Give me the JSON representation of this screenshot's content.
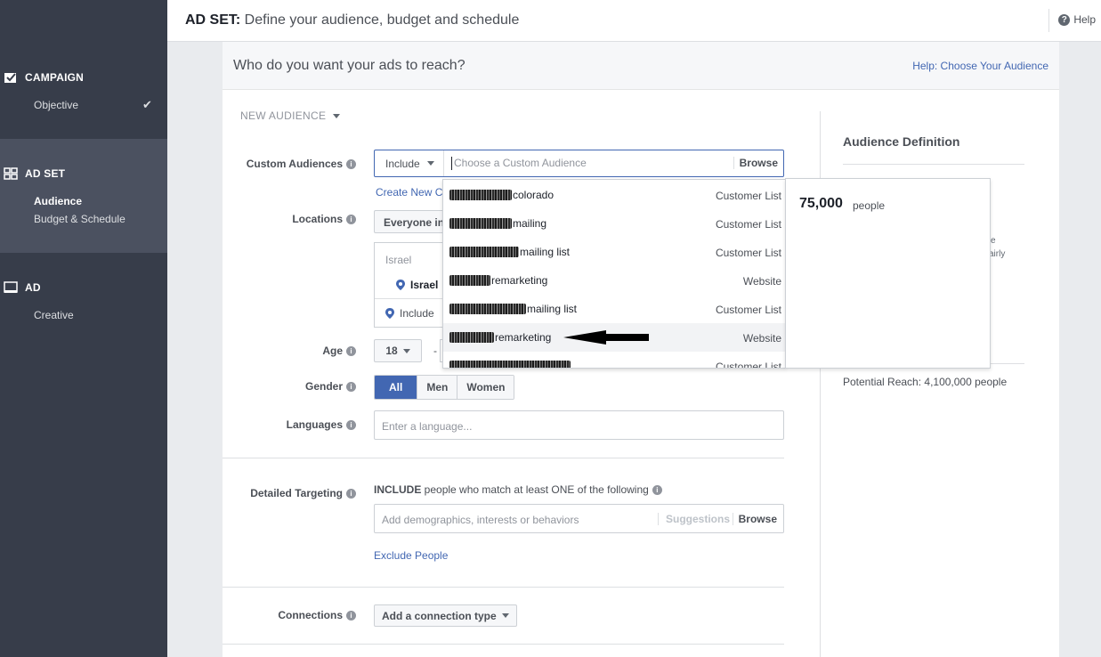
{
  "sidebar": {
    "campaign": {
      "title": "CAMPAIGN",
      "items": [
        {
          "label": "Objective"
        }
      ]
    },
    "adset": {
      "title": "AD SET",
      "items": [
        {
          "label": "Audience"
        },
        {
          "label": "Budget & Schedule"
        }
      ]
    },
    "ad": {
      "title": "AD",
      "items": [
        {
          "label": "Creative"
        }
      ]
    }
  },
  "header": {
    "title_bold": "AD SET:",
    "title_rest": " Define your audience, budget and schedule",
    "help_label": "Help"
  },
  "card": {
    "title": "Who do you want your ads to reach?",
    "help_link": "Help: Choose Your Audience",
    "new_audience": "NEW AUDIENCE"
  },
  "form": {
    "custom_audiences": {
      "label": "Custom Audiences",
      "include": "Include",
      "placeholder": "Choose a Custom Audience",
      "browse": "Browse",
      "create_new": "Create New C"
    },
    "locations": {
      "label": "Locations",
      "button": "Everyone in",
      "country_header": "Israel",
      "selected": "Israel",
      "include": "Include"
    },
    "age": {
      "label": "Age",
      "min": "18",
      "dash": "-"
    },
    "gender": {
      "label": "Gender",
      "options": [
        "All",
        "Men",
        "Women"
      ],
      "selected": "All"
    },
    "languages": {
      "label": "Languages",
      "placeholder": "Enter a language..."
    },
    "detailed_targeting": {
      "label": "Detailed Targeting",
      "desc_bold": "INCLUDE",
      "desc_rest": " people who match at least ONE of the following",
      "placeholder": "Add demographics, interests or behaviors",
      "suggestions": "Suggestions",
      "browse": "Browse",
      "exclude": "Exclude People"
    },
    "connections": {
      "label": "Connections",
      "button": "Add a connection type"
    }
  },
  "dropdown": {
    "items": [
      {
        "name": "colorado",
        "type": "Customer List",
        "blur": 70
      },
      {
        "name": "mailing",
        "type": "Customer List",
        "blur": 70
      },
      {
        "name": "mailing list",
        "type": "Customer List",
        "blur": 78
      },
      {
        "name": "remarketing",
        "type": "Website",
        "blur": 46
      },
      {
        "name": "mailing list",
        "type": "Customer List",
        "blur": 86
      },
      {
        "name": "remarketing",
        "type": "Website",
        "blur": 50
      },
      {
        "name": "",
        "type": "Customer List",
        "blur": 136
      }
    ],
    "highlighted_index": 5
  },
  "hover_panel": {
    "count": "75,000",
    "unit": "people"
  },
  "right_panel": {
    "title": "Audience Definition",
    "frag1": "e",
    "frag2": "airly",
    "potential_reach": "Potential Reach: 4,100,000 people"
  }
}
